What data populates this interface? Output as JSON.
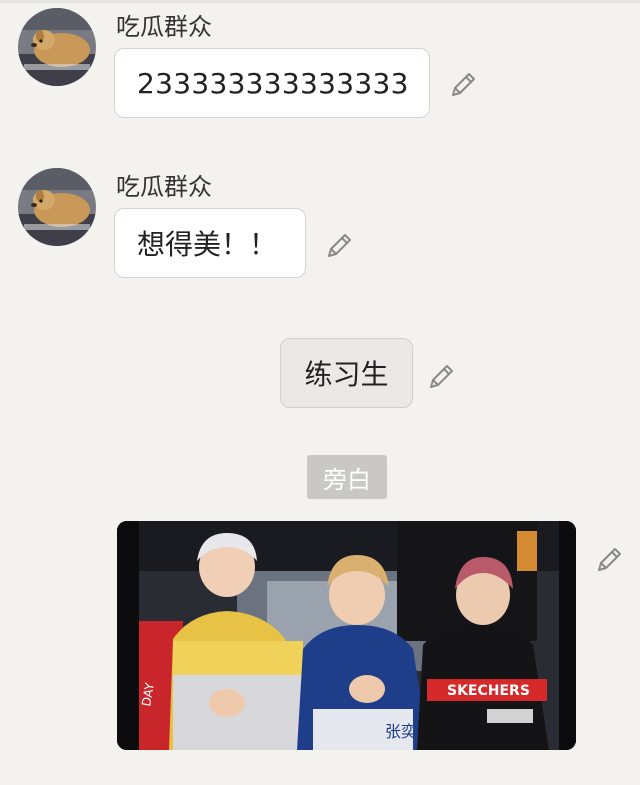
{
  "messages": [
    {
      "sender": "吃瓜群众",
      "text": "233333333333333",
      "avatar_icon": "dog-avatar",
      "edit_icon": "pencil-icon"
    },
    {
      "sender": "吃瓜群众",
      "text": "想得美！！",
      "avatar_icon": "dog-avatar",
      "edit_icon": "pencil-icon"
    },
    {
      "text": "练习生",
      "edit_icon": "pencil-icon"
    }
  ],
  "narration": {
    "label": "旁白"
  },
  "image_message": {
    "description_icon": "photo-three-performers",
    "jersey_text_left": "DAY",
    "brand_text": "SKECHERS",
    "name_text": "张奕",
    "edit_icon": "pencil-icon"
  },
  "colors": {
    "background": "#f4f2ee",
    "bubble": "#ffffff",
    "centered_bubble": "#ebe9e5",
    "narration_tag": "#cac8c5",
    "icon_gray": "#8a8a8a"
  }
}
